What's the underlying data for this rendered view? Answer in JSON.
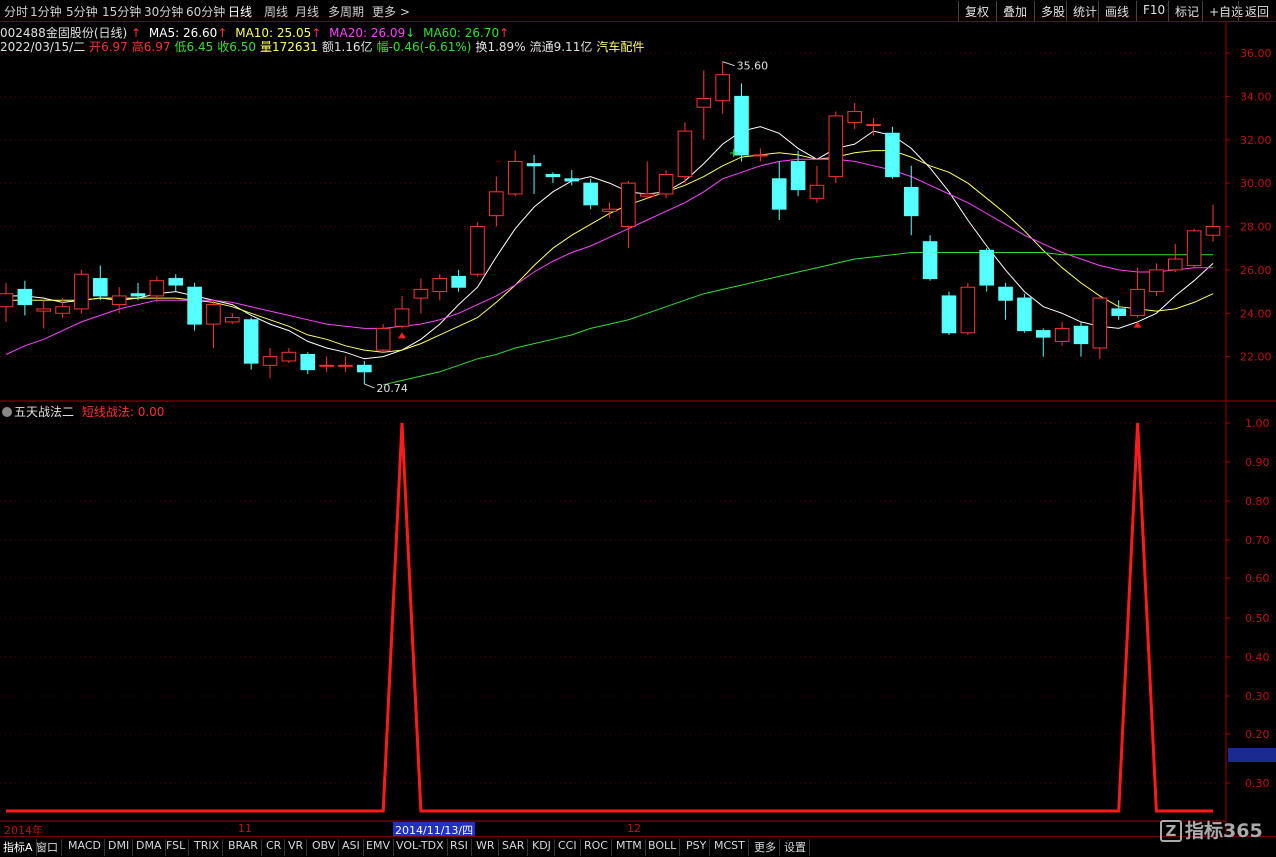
{
  "toolbar": {
    "periods": [
      "分时",
      "1分钟",
      "5分钟",
      "15分钟",
      "30分钟",
      "60分钟",
      "日线",
      "周线",
      "月线",
      "多周期",
      "更多 >"
    ],
    "active_period": "日线",
    "buttons": [
      "复权",
      "叠加",
      "多股",
      "统计",
      "画线",
      "F10",
      "标记",
      "+自选",
      "返回"
    ]
  },
  "stock": {
    "code": "002488",
    "name": "金固股份(日线)",
    "ma5_label": "MA5: 26.60",
    "ma10_label": "MA10: 25.05",
    "ma20_label": "MA20: 26.09",
    "ma60_label": "MA60: 26.70"
  },
  "quote": {
    "date": "2022/03/15/二",
    "open_label": "开",
    "open": "6.97",
    "high_label": "高",
    "high": "6.97",
    "low_label": "低",
    "low": "6.45",
    "close_label": "收",
    "close": "6.50",
    "vol_label": "量",
    "vol": "172631",
    "amount_label": "额",
    "amount": "1.16亿",
    "change_label": "幅",
    "change": "-0.46(-6.61%)",
    "turnover_label": "换",
    "turnover": "1.89%",
    "float_label": "流通",
    "float": "9.11亿",
    "sector": "汽车配件"
  },
  "subchart": {
    "title": "五天战法二",
    "indicator": "短线战法: 0.00"
  },
  "colors": {
    "up": "#ff3232",
    "down": "#54ffff",
    "ma5": "#ffffff",
    "ma10": "#ffff55",
    "ma20": "#ff40ff",
    "ma60": "#30e030",
    "frame": "#a00000"
  },
  "chart_data": [
    {
      "type": "candlestick",
      "ylim": [
        20.0,
        36.6
      ],
      "yticks": [
        "36.00",
        "34.00",
        "32.00",
        "30.00",
        "28.00",
        "26.00",
        "24.00",
        "22.00"
      ],
      "annotations": [
        "35.60",
        "20.74"
      ],
      "candles": [
        {
          "o": 24.3,
          "c": 24.9,
          "h": 25.4,
          "l": 23.6
        },
        {
          "o": 25.1,
          "c": 24.4,
          "h": 25.5,
          "l": 23.9
        },
        {
          "o": 24.1,
          "c": 24.2,
          "h": 24.6,
          "l": 23.3
        },
        {
          "o": 24.0,
          "c": 24.3,
          "h": 24.7,
          "l": 23.8
        },
        {
          "o": 24.2,
          "c": 25.8,
          "h": 26.0,
          "l": 24.0
        },
        {
          "o": 25.6,
          "c": 24.8,
          "h": 26.2,
          "l": 24.6
        },
        {
          "o": 24.4,
          "c": 24.8,
          "h": 25.2,
          "l": 24.0
        },
        {
          "o": 24.9,
          "c": 24.8,
          "h": 25.4,
          "l": 24.6
        },
        {
          "o": 24.8,
          "c": 25.5,
          "h": 25.7,
          "l": 24.5
        },
        {
          "o": 25.6,
          "c": 25.3,
          "h": 25.8,
          "l": 25.0
        },
        {
          "o": 25.2,
          "c": 23.5,
          "h": 25.4,
          "l": 23.2
        },
        {
          "o": 23.5,
          "c": 24.4,
          "h": 24.6,
          "l": 22.4
        },
        {
          "o": 23.6,
          "c": 23.8,
          "h": 24.0,
          "l": 23.5
        },
        {
          "o": 23.7,
          "c": 21.7,
          "h": 23.8,
          "l": 21.4
        },
        {
          "o": 21.6,
          "c": 22.0,
          "h": 22.4,
          "l": 21.0
        },
        {
          "o": 21.8,
          "c": 22.2,
          "h": 22.4,
          "l": 21.7
        },
        {
          "o": 22.1,
          "c": 21.4,
          "h": 22.2,
          "l": 21.2
        },
        {
          "o": 21.6,
          "c": 21.6,
          "h": 22.0,
          "l": 21.3
        },
        {
          "o": 21.6,
          "c": 21.6,
          "h": 22.0,
          "l": 21.3
        },
        {
          "o": 21.6,
          "c": 21.3,
          "h": 21.8,
          "l": 20.74
        },
        {
          "o": 22.3,
          "c": 23.3,
          "h": 23.5,
          "l": 22.2
        },
        {
          "o": 23.4,
          "c": 24.2,
          "h": 24.8,
          "l": 23.3
        },
        {
          "o": 24.7,
          "c": 25.1,
          "h": 25.6,
          "l": 24.0
        },
        {
          "o": 25.0,
          "c": 25.6,
          "h": 25.8,
          "l": 24.6
        },
        {
          "o": 25.7,
          "c": 25.2,
          "h": 26.0,
          "l": 25.0
        },
        {
          "o": 25.8,
          "c": 28.0,
          "h": 28.2,
          "l": 25.7
        },
        {
          "o": 28.5,
          "c": 29.6,
          "h": 30.3,
          "l": 28.0
        },
        {
          "o": 29.5,
          "c": 31.0,
          "h": 31.5,
          "l": 29.4
        },
        {
          "o": 30.9,
          "c": 30.8,
          "h": 31.3,
          "l": 29.5
        },
        {
          "o": 30.4,
          "c": 30.3,
          "h": 30.5,
          "l": 30.0
        },
        {
          "o": 30.2,
          "c": 30.1,
          "h": 30.6,
          "l": 29.9
        },
        {
          "o": 30.0,
          "c": 29.0,
          "h": 30.2,
          "l": 28.8
        },
        {
          "o": 28.7,
          "c": 28.8,
          "h": 29.1,
          "l": 28.4
        },
        {
          "o": 28.0,
          "c": 30.0,
          "h": 30.1,
          "l": 27.0
        },
        {
          "o": 29.4,
          "c": 29.5,
          "h": 31.0,
          "l": 29.3
        },
        {
          "o": 29.5,
          "c": 30.4,
          "h": 30.6,
          "l": 29.3
        },
        {
          "o": 30.3,
          "c": 32.4,
          "h": 32.8,
          "l": 30.0
        },
        {
          "o": 33.5,
          "c": 33.9,
          "h": 35.2,
          "l": 32.0
        },
        {
          "o": 33.8,
          "c": 35.0,
          "h": 35.6,
          "l": 33.2
        },
        {
          "o": 34.0,
          "c": 31.3,
          "h": 34.6,
          "l": 31.0
        },
        {
          "o": 31.3,
          "c": 31.3,
          "h": 31.6,
          "l": 31.0
        },
        {
          "o": 30.2,
          "c": 28.8,
          "h": 31.0,
          "l": 28.3
        },
        {
          "o": 31.0,
          "c": 29.7,
          "h": 31.5,
          "l": 29.4
        },
        {
          "o": 29.3,
          "c": 29.9,
          "h": 30.8,
          "l": 29.1
        },
        {
          "o": 30.3,
          "c": 33.1,
          "h": 33.3,
          "l": 30.0
        },
        {
          "o": 32.8,
          "c": 33.3,
          "h": 33.7,
          "l": 32.5
        },
        {
          "o": 32.7,
          "c": 32.7,
          "h": 33.0,
          "l": 32.2
        },
        {
          "o": 32.3,
          "c": 30.3,
          "h": 32.6,
          "l": 30.2
        },
        {
          "o": 29.8,
          "c": 28.5,
          "h": 30.8,
          "l": 27.6
        },
        {
          "o": 27.3,
          "c": 25.6,
          "h": 27.6,
          "l": 25.5
        },
        {
          "o": 24.8,
          "c": 23.1,
          "h": 25.0,
          "l": 23.0
        },
        {
          "o": 23.1,
          "c": 25.2,
          "h": 25.4,
          "l": 23.0
        },
        {
          "o": 26.9,
          "c": 25.3,
          "h": 27.0,
          "l": 25.0
        },
        {
          "o": 25.2,
          "c": 24.6,
          "h": 25.4,
          "l": 23.7
        },
        {
          "o": 24.7,
          "c": 23.2,
          "h": 24.9,
          "l": 23.1
        },
        {
          "o": 23.2,
          "c": 22.9,
          "h": 23.3,
          "l": 22.0
        },
        {
          "o": 22.7,
          "c": 23.3,
          "h": 23.6,
          "l": 22.5
        },
        {
          "o": 23.4,
          "c": 22.6,
          "h": 23.6,
          "l": 22.0
        },
        {
          "o": 22.4,
          "c": 24.7,
          "h": 24.8,
          "l": 21.9
        },
        {
          "o": 24.2,
          "c": 23.9,
          "h": 24.6,
          "l": 23.7
        },
        {
          "o": 23.9,
          "c": 25.1,
          "h": 26.1,
          "l": 23.8
        },
        {
          "o": 25.0,
          "c": 26.0,
          "h": 26.3,
          "l": 24.8
        },
        {
          "o": 26.0,
          "c": 26.5,
          "h": 27.2,
          "l": 25.9
        },
        {
          "o": 26.2,
          "c": 27.8,
          "h": 27.9,
          "l": 26.1
        },
        {
          "o": 27.6,
          "c": 28.0,
          "h": 29.0,
          "l": 27.3
        }
      ],
      "series": [
        {
          "name": "MA5",
          "values": [
            24.8,
            24.8,
            24.7,
            24.5,
            24.6,
            24.7,
            24.6,
            24.7,
            24.9,
            25.0,
            24.8,
            24.6,
            24.4,
            23.9,
            23.5,
            23.2,
            22.7,
            22.4,
            22.2,
            21.9,
            22.0,
            22.3,
            22.8,
            23.5,
            24.4,
            25.2,
            26.6,
            27.9,
            28.9,
            29.6,
            30.1,
            30.3,
            30.0,
            29.6,
            29.5,
            29.6,
            30.1,
            30.9,
            31.8,
            32.4,
            32.6,
            32.3,
            31.6,
            31.1,
            31.6,
            31.8,
            32.4,
            32.2,
            31.6,
            30.7,
            29.6,
            28.3,
            27.1,
            26.0,
            25.0,
            24.3,
            24.0,
            23.6,
            23.4,
            23.3,
            23.6,
            24.0,
            24.8,
            25.5,
            26.3
          ]
        },
        {
          "name": "MA10",
          "values": [
            24.6,
            24.6,
            24.6,
            24.6,
            24.6,
            24.7,
            24.7,
            24.7,
            24.7,
            24.7,
            24.6,
            24.5,
            24.3,
            24.0,
            23.7,
            23.4,
            23.0,
            22.8,
            22.5,
            22.3,
            22.2,
            22.3,
            22.6,
            23.0,
            23.4,
            23.8,
            24.5,
            25.3,
            26.2,
            27.0,
            27.6,
            28.1,
            28.6,
            29.0,
            29.3,
            29.6,
            29.9,
            30.3,
            30.8,
            31.2,
            31.3,
            31.4,
            31.3,
            31.1,
            31.2,
            31.4,
            31.5,
            31.5,
            31.2,
            30.8,
            30.5,
            30.0,
            29.3,
            28.6,
            27.8,
            26.9,
            26.1,
            25.4,
            24.8,
            24.3,
            24.2,
            24.1,
            24.2,
            24.5,
            24.9
          ]
        },
        {
          "name": "MA20",
          "values": [
            22.1,
            22.5,
            22.8,
            23.2,
            23.6,
            23.9,
            24.2,
            24.4,
            24.6,
            24.6,
            24.6,
            24.6,
            24.5,
            24.3,
            24.1,
            23.9,
            23.7,
            23.5,
            23.4,
            23.3,
            23.3,
            23.4,
            23.5,
            23.7,
            24.0,
            24.4,
            24.8,
            25.3,
            25.9,
            26.4,
            26.8,
            27.1,
            27.5,
            27.9,
            28.3,
            28.7,
            29.1,
            29.6,
            30.2,
            30.5,
            30.8,
            31.0,
            31.1,
            31.1,
            31.1,
            31.0,
            30.8,
            30.6,
            30.3,
            29.9,
            29.5,
            29.1,
            28.6,
            28.1,
            27.6,
            27.2,
            26.8,
            26.5,
            26.2,
            26.0,
            25.9,
            25.9,
            26.0,
            26.1,
            26.1
          ]
        },
        {
          "name": "MA60",
          "values": [
            null,
            null,
            null,
            null,
            null,
            null,
            null,
            null,
            null,
            null,
            null,
            null,
            null,
            null,
            null,
            null,
            null,
            null,
            null,
            null,
            20.7,
            20.9,
            21.1,
            21.3,
            21.6,
            21.9,
            22.1,
            22.4,
            22.6,
            22.8,
            23.0,
            23.3,
            23.5,
            23.7,
            24.0,
            24.3,
            24.6,
            24.9,
            25.1,
            25.3,
            25.5,
            25.7,
            25.9,
            26.1,
            26.3,
            26.5,
            26.6,
            26.7,
            26.8,
            26.8,
            26.8,
            26.8,
            26.8,
            26.8,
            26.8,
            26.8,
            26.7,
            26.7,
            26.7,
            26.7,
            26.7,
            26.7,
            26.7,
            26.7,
            26.7
          ]
        }
      ]
    },
    {
      "type": "line",
      "name": "短线战法",
      "ylim": [
        0.0,
        1.05
      ],
      "yticks": [
        "1.00",
        "0.90",
        "0.80",
        "0.70",
        "0.60",
        "0.50",
        "0.40",
        "0.30",
        "0.20",
        "0.30"
      ],
      "values": [
        0,
        0,
        0,
        0,
        0,
        0,
        0,
        0,
        0,
        0,
        0,
        0,
        0,
        0,
        0,
        0,
        0,
        0,
        0,
        0,
        0,
        1,
        0,
        0,
        0,
        0,
        0,
        0,
        0,
        0,
        0,
        0,
        0,
        0,
        0,
        0,
        0,
        0,
        0,
        0,
        0,
        0,
        0,
        0,
        0,
        0,
        0,
        0,
        0,
        0,
        0,
        0,
        0,
        0,
        0,
        0,
        0,
        0,
        0,
        0,
        1,
        0,
        0,
        0,
        0
      ]
    }
  ],
  "bottom_axis": {
    "labels": [
      "2014年",
      "11",
      "12"
    ],
    "highlight": "2014/11/13/四"
  },
  "tabs": [
    "指标A",
    "窗口",
    "MACD",
    "DMI",
    "DMA",
    "FSL",
    "TRIX",
    "BRAR",
    "CR",
    "VR",
    "OBV",
    "ASI",
    "EMV",
    "VOL-TDX",
    "RSI",
    "WR",
    "SAR",
    "KDJ",
    "CCI",
    "ROC",
    "MTM",
    "BOLL",
    "PSY",
    "MCST",
    "更多",
    "设置"
  ],
  "logo": {
    "text": "指标365"
  }
}
